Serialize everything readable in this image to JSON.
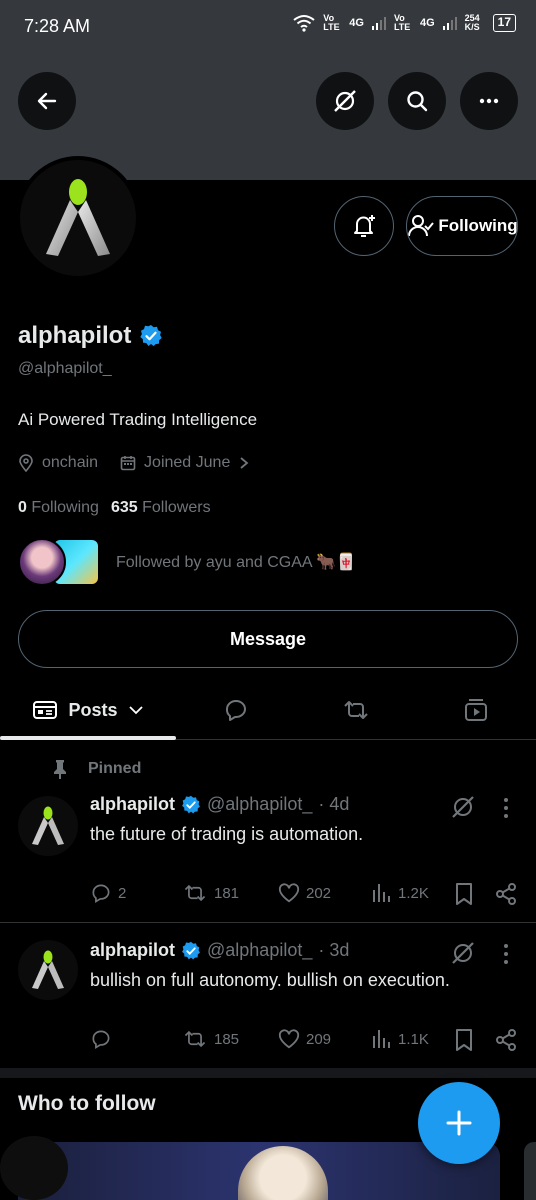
{
  "status": {
    "time": "7:28 AM",
    "net1": "Vo LTE",
    "net2": "4G",
    "net3": "Vo LTE",
    "net4": "4G",
    "speed": "254 K/S",
    "battery": "17"
  },
  "profile": {
    "name": "alphapilot",
    "handle": "@alphapilot_",
    "bio": "Ai Powered Trading Intelligence",
    "location": "onchain",
    "joined": "Joined June",
    "following_count": "0",
    "following_label": "Following",
    "followers_count": "635",
    "followers_label": "Followers",
    "followed_by": "Followed by ayu and CGAA 🐂🀄",
    "following_button": "Following"
  },
  "buttons": {
    "message": "Message"
  },
  "tabs": {
    "posts": "Posts"
  },
  "pinned_label": "Pinned",
  "tweets": [
    {
      "name": "alphapilot",
      "handle": "@alphapilot_",
      "time": "· 4d",
      "text": "the future of trading is automation.",
      "replies": "2",
      "reposts": "181",
      "likes": "202",
      "views": "1.2K"
    },
    {
      "name": "alphapilot",
      "handle": "@alphapilot_",
      "time": "· 3d",
      "text": "bullish on full autonomy. bullish on execution.",
      "replies": "",
      "reposts": "185",
      "likes": "209",
      "views": "1.1K"
    }
  ],
  "who_to_follow": "Who to follow",
  "colors": {
    "accent": "#1d9bf0",
    "verified": "#1d9bf0",
    "banner": "#35393d",
    "logo_green": "#9be31c"
  }
}
